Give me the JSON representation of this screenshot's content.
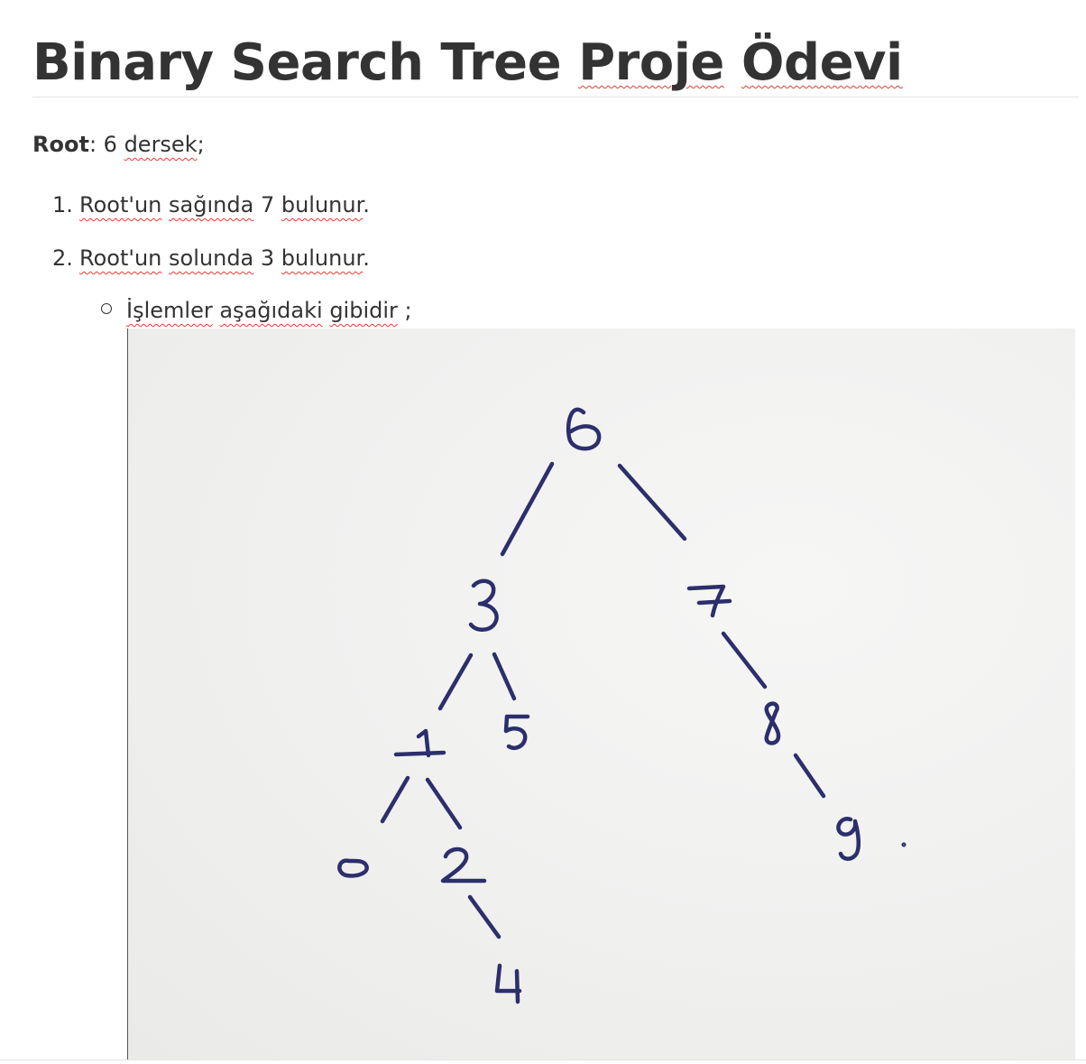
{
  "document": {
    "title_plain": "Binary Search Tree ",
    "title_spell_1": "Proje",
    "title_space": " ",
    "title_spell_2": "Ödevi",
    "root": {
      "label": "Root",
      "text_before": ": 6 ",
      "spell_word": "dersek",
      "text_after": ";"
    },
    "list": [
      {
        "number": "1.",
        "spell_1": "Root'un",
        "space_1": " ",
        "spell_2": "sağında",
        "text": " 7 ",
        "spell_3": "bulunur",
        "end": "."
      },
      {
        "number": "2.",
        "spell_1": "Root'un",
        "space_1": " ",
        "spell_2": "solunda",
        "text": " 3 ",
        "spell_3": "bulunur",
        "end": "."
      }
    ],
    "sub_item": {
      "spell_1": "İşlemler",
      "space_1": " ",
      "spell_2": "aşağıdaki",
      "space_2": " ",
      "spell_3": "gibidir",
      "end": " ;"
    }
  },
  "tree_photo": {
    "ink_color": "#2b2f6b",
    "nodes": [
      "6",
      "3",
      "7",
      "1",
      "5",
      "8",
      "0",
      "2",
      "9",
      "4"
    ]
  }
}
